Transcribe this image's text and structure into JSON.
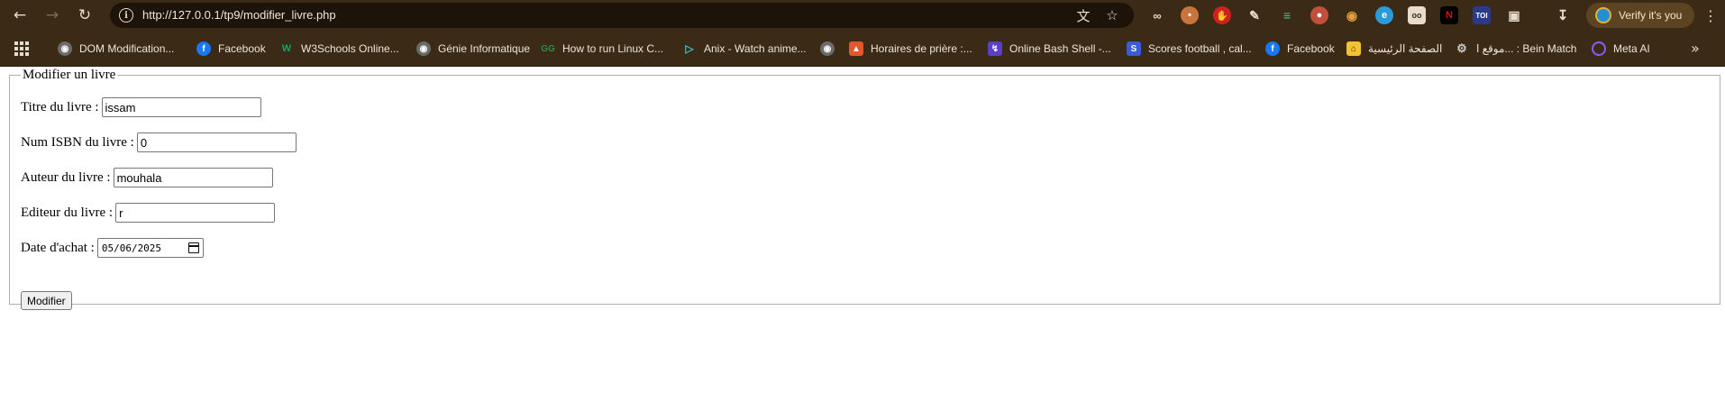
{
  "browser": {
    "url": "http://127.0.0.1/tp9/modifier_livre.php",
    "profile_button_label": "Verify it's you",
    "extensions": [
      "translate-icon",
      "star-icon",
      "reading-mode-icon",
      "cookie-icon",
      "adblock-icon",
      "extension-pin-icon",
      "wappalyzer-icon",
      "chrome-color-icon",
      "ant-icon",
      "edge-icon",
      "captions-icon",
      "netflix-icon",
      "tools-icon",
      "puzzle-icon"
    ]
  },
  "bookmarks": [
    {
      "label": "DOM Modification...",
      "icon": "globe-icon",
      "color": "#6b6b6b"
    },
    {
      "label": "Facebook",
      "icon": "facebook-icon",
      "color": "#1877f2"
    },
    {
      "label": "W3Schools Online...",
      "icon": "w3schools-icon",
      "color": "#04aa6d"
    },
    {
      "label": "Génie Informatique",
      "icon": "globe-icon",
      "color": "#6b6b6b"
    },
    {
      "label": "How to run Linux C...",
      "icon": "gfg-icon",
      "color": "#2f8d46"
    },
    {
      "label": "Anix - Watch anime...",
      "icon": "play-icon",
      "color": "#29c4d6"
    },
    {
      "label": "",
      "icon": "globe-icon",
      "color": "#6b6b6b"
    },
    {
      "label": "Horaires de prière :...",
      "icon": "mosque-icon",
      "color": "#e4572e"
    },
    {
      "label": "Online Bash Shell -...",
      "icon": "bolt-icon",
      "color": "#5b3fc4"
    },
    {
      "label": "Scores football , cal...",
      "icon": "scores-icon",
      "color": "#3b5bdb"
    },
    {
      "label": "Facebook",
      "icon": "facebook-icon",
      "color": "#1877f2"
    },
    {
      "label": "الصفحة الرئيسية",
      "icon": "home-icon",
      "color": "#f2c230"
    },
    {
      "label": "موقع ا... : Bein Match",
      "icon": "gear-icon",
      "color": "#8a8a8a"
    },
    {
      "label": "Meta AI",
      "icon": "meta-ai-icon",
      "color": "#8b5cf6"
    }
  ],
  "form": {
    "legend": "Modifier un livre",
    "fields": [
      {
        "label": "Titre du livre :",
        "value": "issam"
      },
      {
        "label": "Num ISBN du livre :",
        "value": "0"
      },
      {
        "label": "Auteur du livre :",
        "value": "mouhala"
      },
      {
        "label": "Editeur du livre :",
        "value": "r"
      },
      {
        "label": "Date d'achat :",
        "value": "05/06/2025"
      }
    ],
    "submit_label": "Modifier"
  }
}
